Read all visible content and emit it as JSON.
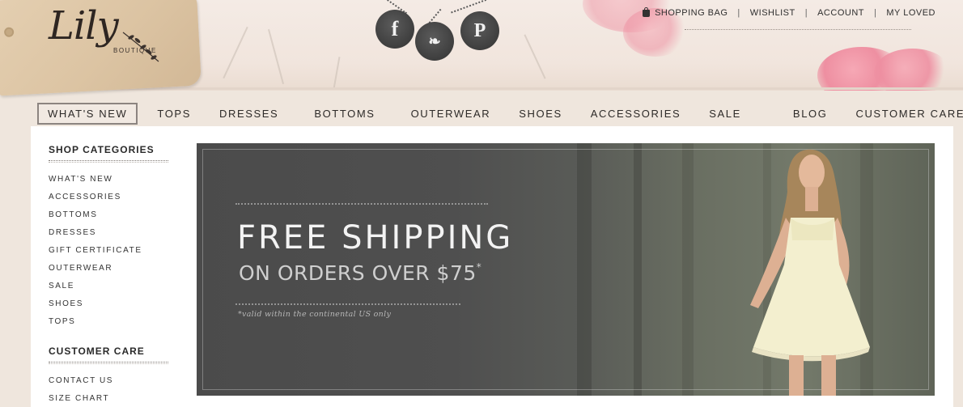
{
  "brand": {
    "name": "Lily",
    "sub": "BOUTIQUE"
  },
  "social": [
    {
      "label": "f",
      "icon": "facebook-icon"
    },
    {
      "label": "❧",
      "icon": "bird-icon"
    },
    {
      "label": "P",
      "icon": "pinterest-icon"
    }
  ],
  "toplinks": {
    "shopping_bag": "SHOPPING BAG",
    "wishlist": "WISHLIST",
    "account": "ACCOUNT",
    "my_loved": "MY LOVED"
  },
  "nav": [
    "WHAT'S NEW",
    "TOPS",
    "DRESSES",
    "BOTTOMS",
    "OUTERWEAR",
    "SHOES",
    "ACCESSORIES",
    "SALE",
    "BLOG",
    "CUSTOMER CARE"
  ],
  "sidebar": {
    "shop_title": "SHOP CATEGORIES",
    "shop_items": [
      "WHAT'S NEW",
      "ACCESSORIES",
      "BOTTOMS",
      "DRESSES",
      "GIFT CERTIFICATE",
      "OUTERWEAR",
      "SALE",
      "SHOES",
      "TOPS"
    ],
    "care_title": "CUSTOMER CARE",
    "care_items": [
      "CONTACT US",
      "SIZE CHART"
    ]
  },
  "banner": {
    "headline": "FREE SHIPPING",
    "subline": "ON ORDERS OVER $75",
    "asterisk": "*",
    "note": "*valid within the continental US only"
  },
  "colors": {
    "accent_pink": "#ee8fa1",
    "banner_gray": "#4b4b4b",
    "text_dark": "#2d2a28"
  }
}
